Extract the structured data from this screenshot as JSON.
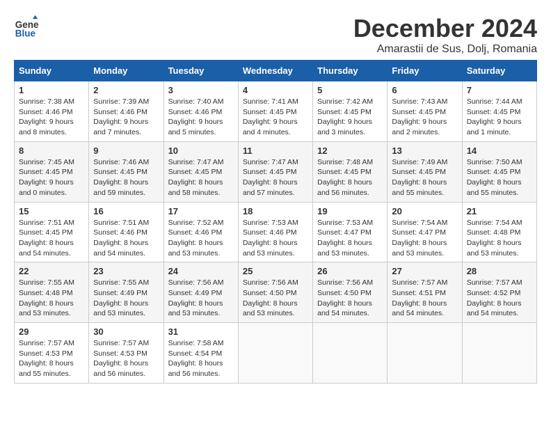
{
  "header": {
    "logo_line1": "General",
    "logo_line2": "Blue",
    "month_year": "December 2024",
    "location": "Amarastii de Sus, Dolj, Romania"
  },
  "days_of_week": [
    "Sunday",
    "Monday",
    "Tuesday",
    "Wednesday",
    "Thursday",
    "Friday",
    "Saturday"
  ],
  "weeks": [
    [
      {
        "day": 1,
        "sunrise": "7:38 AM",
        "sunset": "4:46 PM",
        "daylight": "9 hours and 8 minutes."
      },
      {
        "day": 2,
        "sunrise": "7:39 AM",
        "sunset": "4:46 PM",
        "daylight": "9 hours and 7 minutes."
      },
      {
        "day": 3,
        "sunrise": "7:40 AM",
        "sunset": "4:46 PM",
        "daylight": "9 hours and 5 minutes."
      },
      {
        "day": 4,
        "sunrise": "7:41 AM",
        "sunset": "4:45 PM",
        "daylight": "9 hours and 4 minutes."
      },
      {
        "day": 5,
        "sunrise": "7:42 AM",
        "sunset": "4:45 PM",
        "daylight": "9 hours and 3 minutes."
      },
      {
        "day": 6,
        "sunrise": "7:43 AM",
        "sunset": "4:45 PM",
        "daylight": "9 hours and 2 minutes."
      },
      {
        "day": 7,
        "sunrise": "7:44 AM",
        "sunset": "4:45 PM",
        "daylight": "9 hours and 1 minute."
      }
    ],
    [
      {
        "day": 8,
        "sunrise": "7:45 AM",
        "sunset": "4:45 PM",
        "daylight": "9 hours and 0 minutes."
      },
      {
        "day": 9,
        "sunrise": "7:46 AM",
        "sunset": "4:45 PM",
        "daylight": "8 hours and 59 minutes."
      },
      {
        "day": 10,
        "sunrise": "7:47 AM",
        "sunset": "4:45 PM",
        "daylight": "8 hours and 58 minutes."
      },
      {
        "day": 11,
        "sunrise": "7:47 AM",
        "sunset": "4:45 PM",
        "daylight": "8 hours and 57 minutes."
      },
      {
        "day": 12,
        "sunrise": "7:48 AM",
        "sunset": "4:45 PM",
        "daylight": "8 hours and 56 minutes."
      },
      {
        "day": 13,
        "sunrise": "7:49 AM",
        "sunset": "4:45 PM",
        "daylight": "8 hours and 55 minutes."
      },
      {
        "day": 14,
        "sunrise": "7:50 AM",
        "sunset": "4:45 PM",
        "daylight": "8 hours and 55 minutes."
      }
    ],
    [
      {
        "day": 15,
        "sunrise": "7:51 AM",
        "sunset": "4:45 PM",
        "daylight": "8 hours and 54 minutes."
      },
      {
        "day": 16,
        "sunrise": "7:51 AM",
        "sunset": "4:46 PM",
        "daylight": "8 hours and 54 minutes."
      },
      {
        "day": 17,
        "sunrise": "7:52 AM",
        "sunset": "4:46 PM",
        "daylight": "8 hours and 53 minutes."
      },
      {
        "day": 18,
        "sunrise": "7:53 AM",
        "sunset": "4:46 PM",
        "daylight": "8 hours and 53 minutes."
      },
      {
        "day": 19,
        "sunrise": "7:53 AM",
        "sunset": "4:47 PM",
        "daylight": "8 hours and 53 minutes."
      },
      {
        "day": 20,
        "sunrise": "7:54 AM",
        "sunset": "4:47 PM",
        "daylight": "8 hours and 53 minutes."
      },
      {
        "day": 21,
        "sunrise": "7:54 AM",
        "sunset": "4:48 PM",
        "daylight": "8 hours and 53 minutes."
      }
    ],
    [
      {
        "day": 22,
        "sunrise": "7:55 AM",
        "sunset": "4:48 PM",
        "daylight": "8 hours and 53 minutes."
      },
      {
        "day": 23,
        "sunrise": "7:55 AM",
        "sunset": "4:49 PM",
        "daylight": "8 hours and 53 minutes."
      },
      {
        "day": 24,
        "sunrise": "7:56 AM",
        "sunset": "4:49 PM",
        "daylight": "8 hours and 53 minutes."
      },
      {
        "day": 25,
        "sunrise": "7:56 AM",
        "sunset": "4:50 PM",
        "daylight": "8 hours and 53 minutes."
      },
      {
        "day": 26,
        "sunrise": "7:56 AM",
        "sunset": "4:50 PM",
        "daylight": "8 hours and 54 minutes."
      },
      {
        "day": 27,
        "sunrise": "7:57 AM",
        "sunset": "4:51 PM",
        "daylight": "8 hours and 54 minutes."
      },
      {
        "day": 28,
        "sunrise": "7:57 AM",
        "sunset": "4:52 PM",
        "daylight": "8 hours and 54 minutes."
      }
    ],
    [
      {
        "day": 29,
        "sunrise": "7:57 AM",
        "sunset": "4:53 PM",
        "daylight": "8 hours and 55 minutes."
      },
      {
        "day": 30,
        "sunrise": "7:57 AM",
        "sunset": "4:53 PM",
        "daylight": "8 hours and 56 minutes."
      },
      {
        "day": 31,
        "sunrise": "7:58 AM",
        "sunset": "4:54 PM",
        "daylight": "8 hours and 56 minutes."
      },
      null,
      null,
      null,
      null
    ]
  ]
}
